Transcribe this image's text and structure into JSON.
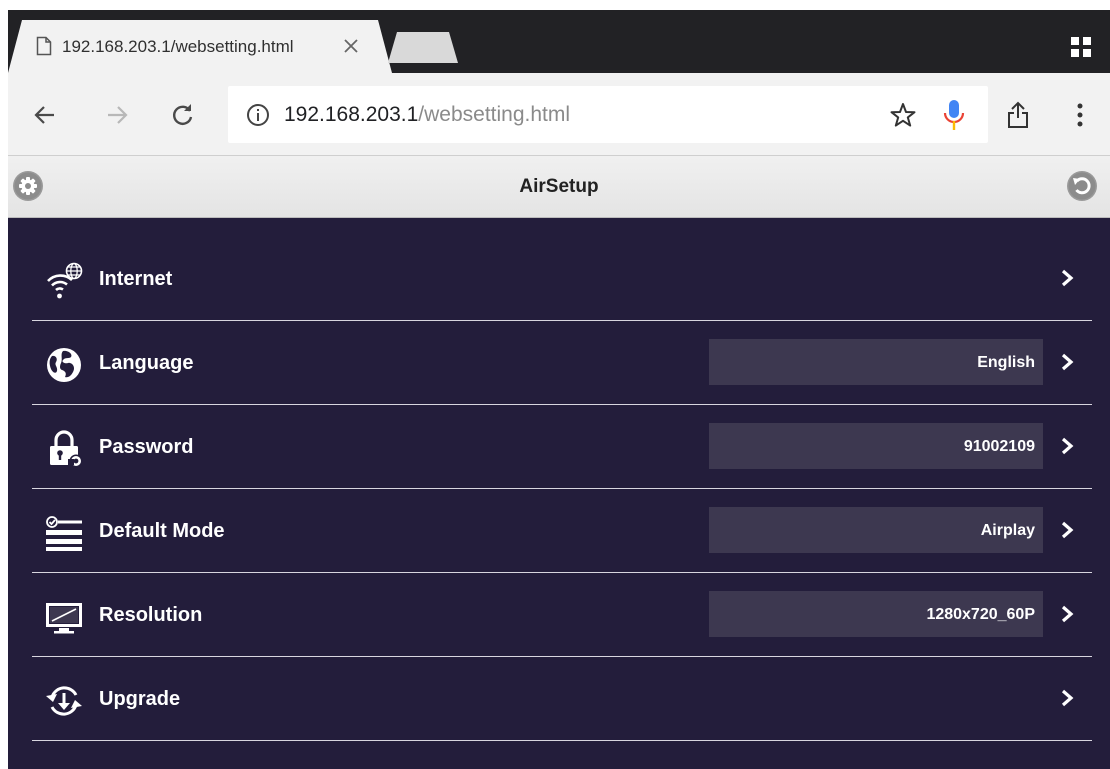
{
  "browser": {
    "tab": {
      "title": "192.168.203.1/websetting.html"
    },
    "url": {
      "host": "192.168.203.1",
      "path": "/websetting.html"
    }
  },
  "app": {
    "title": "AirSetup"
  },
  "settings": [
    {
      "label": "Internet",
      "value": null,
      "icon": "wifi-globe-icon"
    },
    {
      "label": "Language",
      "value": "English",
      "icon": "globe-icon"
    },
    {
      "label": "Password",
      "value": "91002109",
      "icon": "lock-icon"
    },
    {
      "label": "Default Mode",
      "value": "Airplay",
      "icon": "mode-list-icon"
    },
    {
      "label": "Resolution",
      "value": "1280x720_60P",
      "icon": "monitor-icon"
    },
    {
      "label": "Upgrade",
      "value": null,
      "icon": "upgrade-icon"
    }
  ],
  "colors": {
    "content_background": "#231d3b",
    "value_box": "#3d3850",
    "tabbar": "#222225",
    "mic_blue": "#4285f4",
    "mic_stem": "#fbbc05"
  }
}
